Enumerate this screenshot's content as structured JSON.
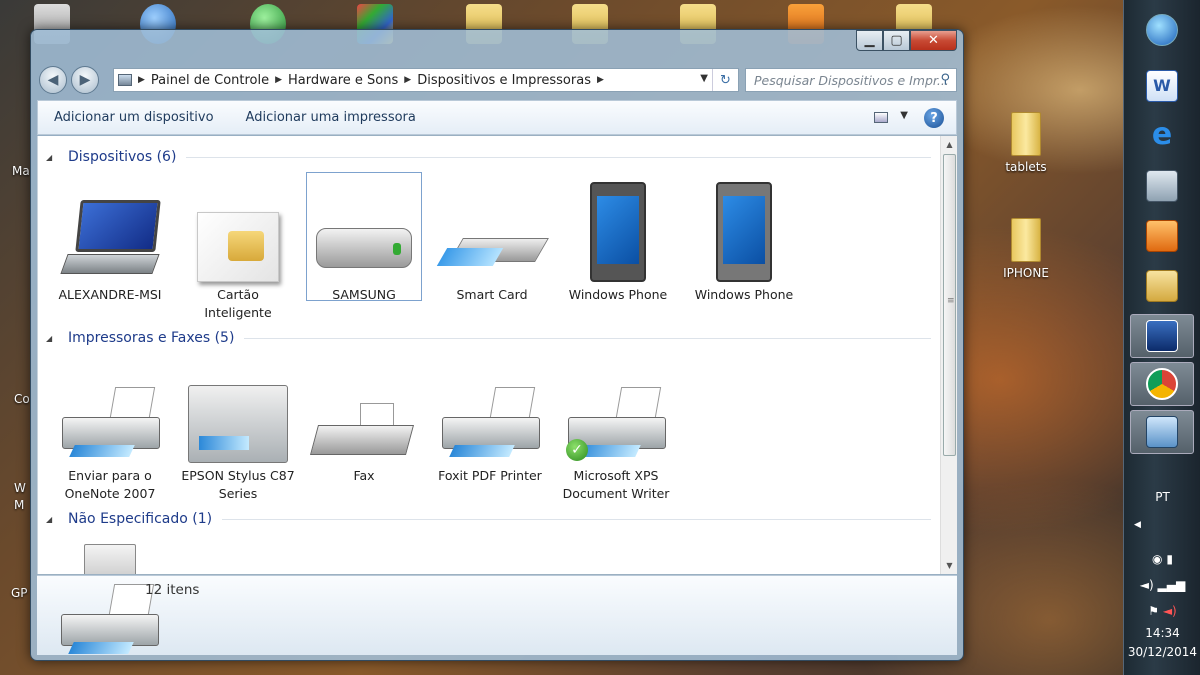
{
  "desktop": {
    "icons": [
      {
        "label": "tablets"
      },
      {
        "label": "IPHONE"
      }
    ],
    "edge_labels": [
      "Ma",
      "Co",
      "W",
      "M",
      "GP"
    ]
  },
  "window": {
    "breadcrumb": [
      "Painel de Controle",
      "Hardware e Sons",
      "Dispositivos e Impressoras"
    ],
    "search_placeholder": "Pesquisar Dispositivos e Impr...",
    "commands": {
      "add_device": "Adicionar um dispositivo",
      "add_printer": "Adicionar uma impressora"
    },
    "groups": {
      "devices": {
        "title": "Dispositivos (6)"
      },
      "printers": {
        "title": "Impressoras e Faxes (5)"
      },
      "unspecified": {
        "title": "Não Especificado (1)"
      }
    },
    "devices": [
      {
        "label": "ALEXANDRE-MSI",
        "icon": "laptop-icon"
      },
      {
        "label": "Cartão Inteligente",
        "icon": "smart-card-icon"
      },
      {
        "label": "SAMSUNG",
        "icon": "external-drive-icon",
        "selected": true
      },
      {
        "label": "Smart Card",
        "icon": "card-reader-icon"
      },
      {
        "label": "Windows Phone",
        "icon": "windows-phone-icon"
      },
      {
        "label": "Windows Phone",
        "icon": "windows-phone-icon"
      }
    ],
    "printers": [
      {
        "label": "Enviar para o OneNote 2007",
        "icon": "printer-icon"
      },
      {
        "label": "EPSON Stylus C87 Series",
        "icon": "multifunction-printer-icon"
      },
      {
        "label": "Fax",
        "icon": "fax-icon"
      },
      {
        "label": "Foxit PDF Printer",
        "icon": "printer-icon"
      },
      {
        "label": "Microsoft XPS Document Writer",
        "icon": "printer-icon",
        "default": true
      }
    ],
    "details": {
      "count": "12 itens"
    }
  },
  "taskbar": {
    "language": "PT",
    "time": "14:34",
    "date": "30/12/2014",
    "pinned": [
      "start-orb-icon",
      "word-icon",
      "internet-explorer-icon",
      "calculator-icon",
      "media-player-icon",
      "explorer-icon",
      "dance-app-icon",
      "chrome-icon",
      "control-panel-icon"
    ]
  },
  "colors": {
    "accent": "#1e3b8a",
    "close": "#c84a34"
  }
}
